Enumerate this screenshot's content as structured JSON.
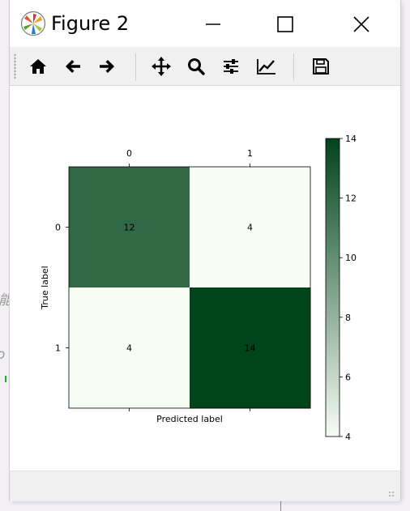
{
  "window": {
    "title": "Figure 2"
  },
  "toolbar": {
    "buttons": [
      {
        "icon": "home-icon",
        "name": "home"
      },
      {
        "icon": "arrow-left-icon",
        "name": "back"
      },
      {
        "icon": "arrow-right-icon",
        "name": "forward"
      },
      {
        "icon": "move-icon",
        "name": "pan"
      },
      {
        "icon": "magnifier-icon",
        "name": "zoom"
      },
      {
        "icon": "sliders-icon",
        "name": "configure-subplots"
      },
      {
        "icon": "chart-line-icon",
        "name": "edit-axis"
      },
      {
        "icon": "floppy-disk-icon",
        "name": "save"
      }
    ]
  },
  "background": {
    "fragment_1": "能",
    "fragment_2": "o"
  },
  "chart_data": {
    "type": "heatmap",
    "title": "",
    "xlabel": "Predicted label",
    "ylabel": "True label",
    "x_ticks": [
      "0",
      "1"
    ],
    "y_ticks": [
      "0",
      "1"
    ],
    "matrix": [
      [
        12,
        4
      ],
      [
        4,
        14
      ]
    ],
    "cell_labels": [
      [
        "12",
        "4"
      ],
      [
        "4",
        "14"
      ]
    ],
    "colormap": "Greens",
    "colors": {
      "low": "#f7fcf5",
      "high": "#00441b"
    },
    "colorbar": {
      "range": [
        4,
        14
      ],
      "ticks": [
        "4",
        "6",
        "8",
        "10",
        "12",
        "14"
      ]
    }
  }
}
